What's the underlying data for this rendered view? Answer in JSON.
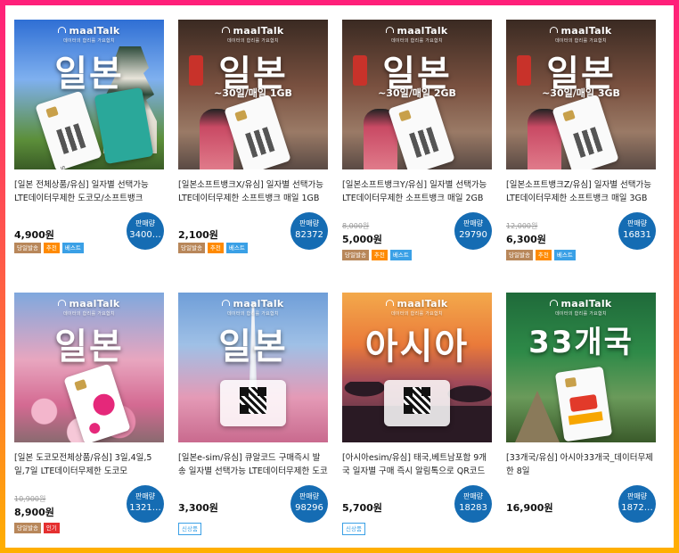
{
  "brand": {
    "logo": "maalTalk",
    "logo_sub": "데이터의 합리를 가요합치"
  },
  "products": [
    {
      "big": "일본",
      "sub": "",
      "title": "[일본 전체상품/유심] 일자별 선택가능 LTE데이터무제한 도코모/소프트뱅크",
      "original_price": "",
      "price": "4,900원",
      "tags": [
        {
          "label": "당일발송",
          "style": "brown"
        },
        {
          "label": "추천",
          "style": "orange"
        },
        {
          "label": "베스트",
          "style": "blue"
        }
      ],
      "sales_label": "판매량",
      "sales_count": "3400…"
    },
    {
      "big": "일본",
      "sub": "~30일/매일 1GB",
      "title": "[일본소프트뱅크X/유심] 일자별 선택가능 LTE데이터무제한 소프트뱅크 매일 1GB",
      "original_price": "",
      "price": "2,100원",
      "tags": [
        {
          "label": "당일발송",
          "style": "brown"
        },
        {
          "label": "추천",
          "style": "orange"
        },
        {
          "label": "베스트",
          "style": "blue"
        }
      ],
      "sales_label": "판매량",
      "sales_count": "82372"
    },
    {
      "big": "일본",
      "sub": "~30일/매일 2GB",
      "title": "[일본소프트뱅크Y/유심] 일자별 선택가능 LTE데이터무제한 소프트뱅크 매일 2GB",
      "original_price": "8,000원",
      "price": "5,000원",
      "tags": [
        {
          "label": "당일발송",
          "style": "brown"
        },
        {
          "label": "추천",
          "style": "orange"
        },
        {
          "label": "베스트",
          "style": "blue"
        }
      ],
      "sales_label": "판매량",
      "sales_count": "29790"
    },
    {
      "big": "일본",
      "sub": "~30일/매일 3GB",
      "title": "[일본소프트뱅크Z/유심] 일자별 선택가능 LTE데이터무제한 소프트뱅크 매일 3GB",
      "original_price": "12,000원",
      "price": "6,300원",
      "tags": [
        {
          "label": "당일발송",
          "style": "brown"
        },
        {
          "label": "추천",
          "style": "orange"
        },
        {
          "label": "베스트",
          "style": "blue"
        }
      ],
      "sales_label": "판매량",
      "sales_count": "16831"
    },
    {
      "big": "일본",
      "sub": "",
      "title": "[일본 도코모전체상품/유심] 3일,4일,5일,7일 LTE데이터무제한 도코모",
      "original_price": "10,900원",
      "price": "8,900원",
      "tags": [
        {
          "label": "당일발송",
          "style": "brown"
        },
        {
          "label": "인기",
          "style": "red"
        }
      ],
      "sales_label": "판매량",
      "sales_count": "1321…"
    },
    {
      "big": "일본",
      "sub": "",
      "title": "[일본e-sim/유심] 큐알코드 구매즉시 발송 일자별 선택가능 LTE데이터무제한 도코모/소프트뱅크",
      "original_price": "",
      "price": "3,300원",
      "tags": [
        {
          "label": "신상품",
          "style": "outline"
        }
      ],
      "sales_label": "판매량",
      "sales_count": "98296"
    },
    {
      "big": "아시아",
      "sub": "",
      "title": "[아시아esim/유심] 태국,베트남포함 9개국 일자별 구매 즉시 알림톡으로 QR코드 발송 사용 가능 데이터무제한",
      "original_price": "",
      "price": "5,700원",
      "tags": [
        {
          "label": "신상품",
          "style": "outline"
        }
      ],
      "sales_label": "판매량",
      "sales_count": "18283"
    },
    {
      "big": "33개국",
      "sub": "",
      "title": "[33개국/유심] 아시아33개국_데이터무제한 8일",
      "original_price": "",
      "price": "16,900원",
      "tags": [],
      "sales_label": "판매량",
      "sales_count": "1872…"
    }
  ]
}
